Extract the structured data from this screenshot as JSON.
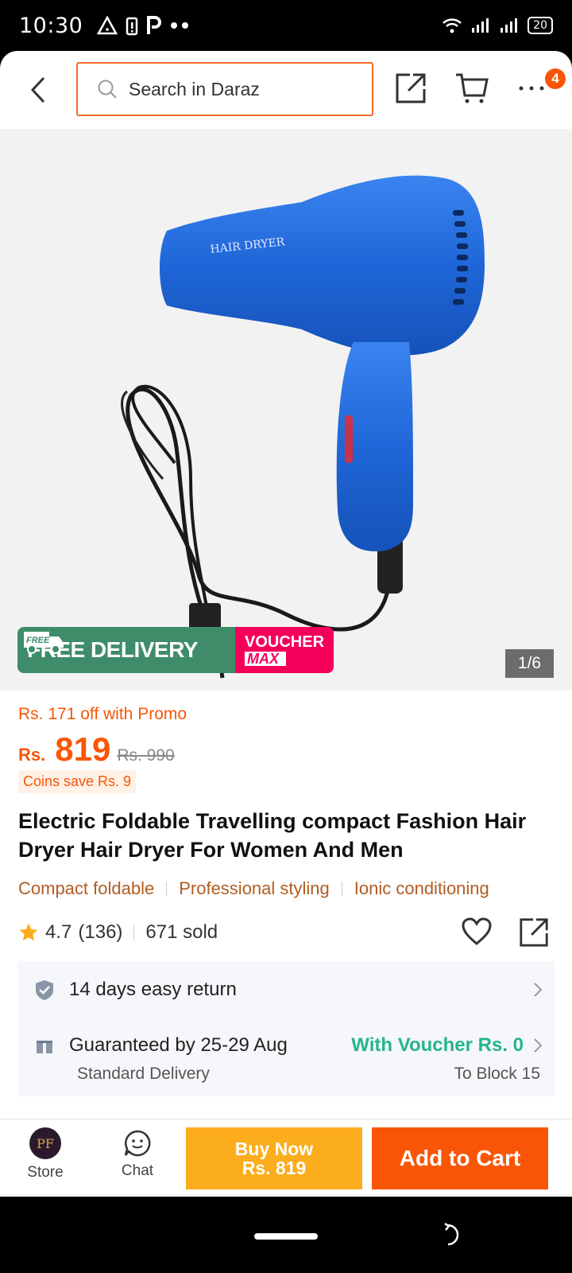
{
  "status_bar": {
    "time": "10:30",
    "battery": "20"
  },
  "header": {
    "search_placeholder": "Search in Daraz",
    "cart_badge": "4"
  },
  "gallery": {
    "page_indicator": "1/6",
    "product_print": "HAIR DRYER",
    "banner": {
      "free_small": "FREE",
      "free_delivery": "FREE DELIVERY",
      "voucher": "VOUCHER",
      "max": "MAX"
    }
  },
  "product": {
    "promo_text": "Rs. 171 off with Promo",
    "currency": "Rs.",
    "price": "819",
    "original_price": "Rs. 990",
    "coins": "Coins save Rs. 9",
    "title": "Electric Foldable Travelling compact Fashion Hair Dryer Hair Dryer For Women And Men",
    "tags": [
      "Compact foldable",
      "Professional styling",
      "Ionic conditioning"
    ],
    "rating": "4.7",
    "reviews": "(136)",
    "sold": "671 sold"
  },
  "service": {
    "return_text": "14 days easy return",
    "delivery_text": "Guaranteed by 25-29 Aug",
    "voucher_text": "With Voucher Rs. 0",
    "delivery_type": "Standard Delivery",
    "destination": "To Block 15"
  },
  "bottom_bar": {
    "store_logo": "PF",
    "store_label": "Store",
    "chat_label": "Chat",
    "buy_now_line1": "Buy Now",
    "buy_now_line2": "Rs. 819",
    "add_to_cart": "Add to Cart"
  },
  "colors": {
    "accent": "#f85606",
    "promo_green": "#27b48e",
    "buy_now": "#fcad1d",
    "product_blue": "#1f66d8"
  }
}
